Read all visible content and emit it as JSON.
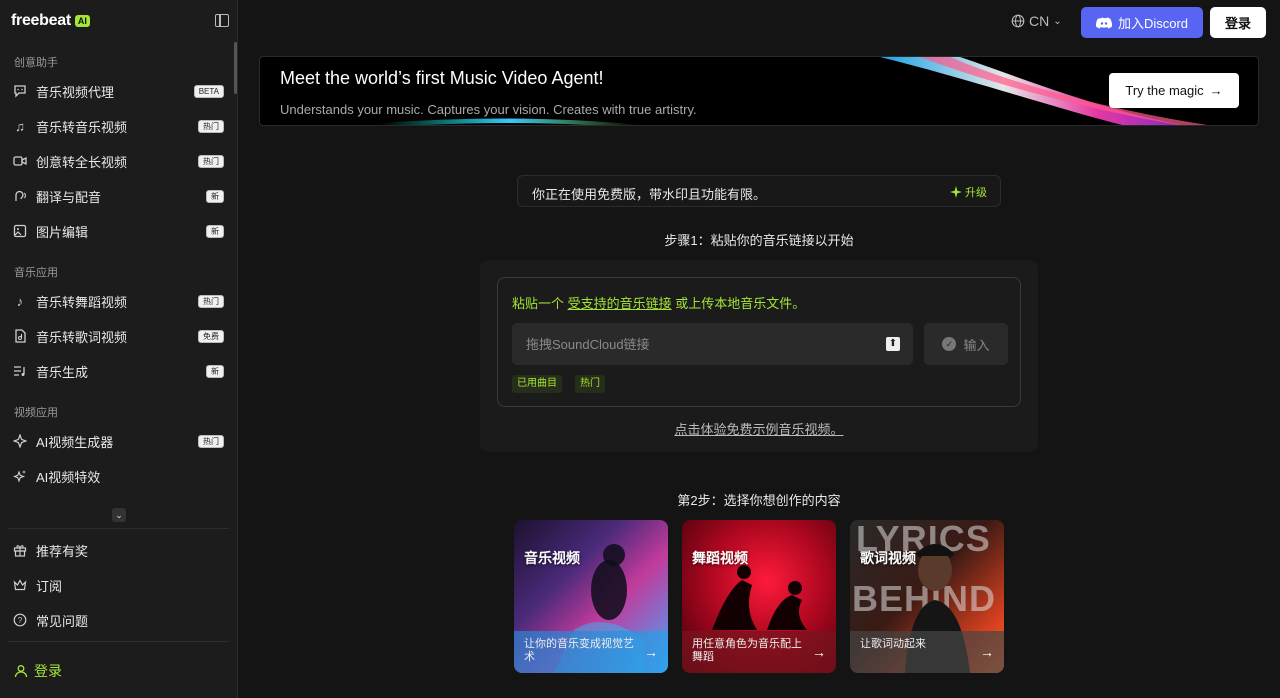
{
  "app": {
    "logo_text": "freebeat",
    "logo_badge": "AI"
  },
  "sidebar": {
    "section_creative": "创意助手",
    "section_music": "音乐应用",
    "section_video": "视频应用",
    "items_creative": [
      {
        "label": "音乐视频代理",
        "badge": "BETA",
        "icon": "chat-icon"
      },
      {
        "label": "音乐转音乐视频",
        "badge": "热门",
        "icon": "music-note-icon"
      },
      {
        "label": "创意转全长视频",
        "badge": "热门",
        "icon": "video-camera-icon"
      },
      {
        "label": "翻译与配音",
        "badge": "新",
        "icon": "voice-icon"
      },
      {
        "label": "图片编辑",
        "badge": "新",
        "icon": "image-edit-icon"
      }
    ],
    "items_music": [
      {
        "label": "音乐转舞蹈视频",
        "badge": "热门",
        "icon": "dance-note-icon"
      },
      {
        "label": "音乐转歌词视频",
        "badge": "免费",
        "icon": "lyrics-icon"
      },
      {
        "label": "音乐生成",
        "badge": "新",
        "icon": "music-list-icon"
      }
    ],
    "items_video": [
      {
        "label": "AI视频生成器",
        "badge": "热门",
        "icon": "sparkle-icon"
      },
      {
        "label": "AI视频特效",
        "badge": "",
        "icon": "sparkles-icon"
      }
    ],
    "bottom_items": [
      {
        "label": "推荐有奖",
        "icon": "gift-icon"
      },
      {
        "label": "订阅",
        "icon": "crown-icon"
      },
      {
        "label": "常见问题",
        "icon": "help-icon"
      }
    ],
    "login_label": "登录"
  },
  "topbar": {
    "language": "CN",
    "discord_label": "加入Discord",
    "login_label": "登录"
  },
  "banner": {
    "title": "Meet the world’s first Music Video Agent!",
    "subtitle": "Understands your music. Captures your vision. Creates with true artistry.",
    "cta": "Try the magic"
  },
  "notice": {
    "text": "你正在使用免费版，带水印且功能有限。",
    "upgrade_label": "升级"
  },
  "step1": {
    "title": "步骤1：粘贴你的音乐链接以开始",
    "paste_prefix": "粘贴一个 ",
    "paste_link": "受支持的音乐链接",
    "paste_suffix": " 或上传本地音乐文件。",
    "input_placeholder": "拖拽SoundCloud链接",
    "enter_label": "输入",
    "tags": [
      "已用曲目",
      "热门"
    ],
    "demo_link": "点击体验免费示例音乐视频。"
  },
  "step2": {
    "title": "第2步：选择你想创作的内容",
    "cards": [
      {
        "title": "音乐视频",
        "desc": "让你的音乐变成视觉艺术"
      },
      {
        "title": "舞蹈视频",
        "desc": "用任意角色为音乐配上舞蹈"
      },
      {
        "title": "歌词视频",
        "desc": "让歌词动起来",
        "art_text_1": "LYRICS",
        "art_text_2": "BEHIND"
      }
    ]
  }
}
